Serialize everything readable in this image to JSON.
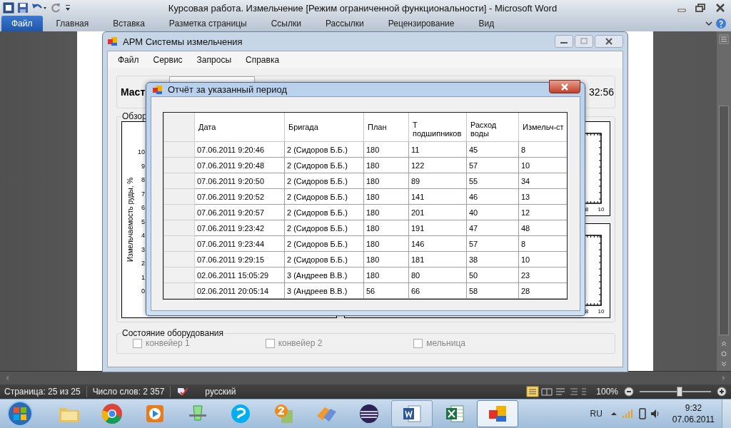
{
  "word": {
    "title": "Курсовая работа. Измельчение [Режим ограниченной функциональности]  -  Microsoft Word",
    "ribbon_tabs": [
      {
        "label": "Файл",
        "selected": true
      },
      {
        "label": "Главная",
        "selected": false
      },
      {
        "label": "Вставка",
        "selected": false
      },
      {
        "label": "Разметка страницы",
        "selected": false
      },
      {
        "label": "Ссылки",
        "selected": false
      },
      {
        "label": "Рассылки",
        "selected": false
      },
      {
        "label": "Рецензирование",
        "selected": false
      },
      {
        "label": "Вид",
        "selected": false
      }
    ],
    "status": {
      "page": "Страница: 25 из 25",
      "words": "Число слов: 2 357",
      "language": "русский",
      "zoom": "100%",
      "level": 0.55
    }
  },
  "app_window": {
    "title": "АРМ Системы измельчения",
    "menu": [
      "Файл",
      "Сервис",
      "Запросы",
      "Справка"
    ],
    "master_label": "Маст",
    "clock": "32:56",
    "overview_label": "Обзор",
    "chart_axis_label": "Измельчаемость руды, %",
    "y_ticks": [
      "10",
      "9",
      "8",
      "7",
      "6",
      "5",
      "4",
      "3",
      "2",
      "1",
      "0"
    ],
    "small_charts": [
      {
        "x_ticks": [
          "8",
          "10"
        ]
      },
      {
        "x_ticks": [
          "8",
          "10"
        ]
      }
    ],
    "equipment_label": "Состояние оборудования",
    "equipment": [
      {
        "label": "конвейер 1",
        "checked": false,
        "disabled": true
      },
      {
        "label": "конвейер 2",
        "checked": false,
        "disabled": true
      },
      {
        "label": "мельница",
        "checked": false,
        "disabled": true
      }
    ]
  },
  "dialog": {
    "title": "Отчёт за указанный период",
    "table": {
      "columns": [
        "Дата",
        "Бригада",
        "План",
        "Т подшипников",
        "Расход воды",
        "Измельч-ст"
      ],
      "rows": [
        [
          "07.06.2011 9:20:46",
          "2 (Сидоров Б.Б.)",
          "180",
          "11",
          "45",
          "8"
        ],
        [
          "07.06.2011 9:20:48",
          "2 (Сидоров Б.Б.)",
          "180",
          "122",
          "57",
          "10"
        ],
        [
          "07.06.2011 9:20:50",
          "2 (Сидоров Б.Б.)",
          "180",
          "89",
          "55",
          "34"
        ],
        [
          "07.06.2011 9:20:52",
          "2 (Сидоров Б.Б.)",
          "180",
          "141",
          "46",
          "13"
        ],
        [
          "07.06.2011 9:20:57",
          "2 (Сидоров Б.Б.)",
          "180",
          "201",
          "40",
          "12"
        ],
        [
          "07.06.2011 9:23:42",
          "2 (Сидоров Б.Б.)",
          "180",
          "191",
          "47",
          "48"
        ],
        [
          "07.06.2011 9:23:44",
          "2 (Сидоров Б.Б.)",
          "180",
          "146",
          "57",
          "8"
        ],
        [
          "07.06.2011 9:29:15",
          "2 (Сидоров Б.Б.)",
          "180",
          "181",
          "38",
          "10"
        ],
        [
          "02.06.2011 15:05:29",
          "3 (Андреев В.В.)",
          "180",
          "80",
          "50",
          "23"
        ],
        [
          "02.06.2011 20:05:14",
          "3 (Андреев В.В.)",
          "56",
          "66",
          "58",
          "28"
        ]
      ]
    }
  },
  "taskbar": {
    "apps": [
      {
        "kind": "folder",
        "running": false,
        "selected": false
      },
      {
        "kind": "browser",
        "running": false,
        "selected": false
      },
      {
        "kind": "player",
        "running": false,
        "selected": false
      },
      {
        "kind": "glass",
        "running": false,
        "selected": false
      },
      {
        "kind": "phone",
        "running": false,
        "selected": false
      },
      {
        "kind": "badge",
        "running": false,
        "selected": false
      },
      {
        "kind": "tool",
        "running": false,
        "selected": false
      },
      {
        "kind": "sphere",
        "running": false,
        "selected": false
      },
      {
        "kind": "word",
        "running": true,
        "selected": false
      },
      {
        "kind": "excel",
        "running": false,
        "selected": false
      },
      {
        "kind": "app",
        "running": true,
        "selected": true
      }
    ],
    "language": "RU",
    "time": "9:32",
    "date": "07.06.2011"
  }
}
